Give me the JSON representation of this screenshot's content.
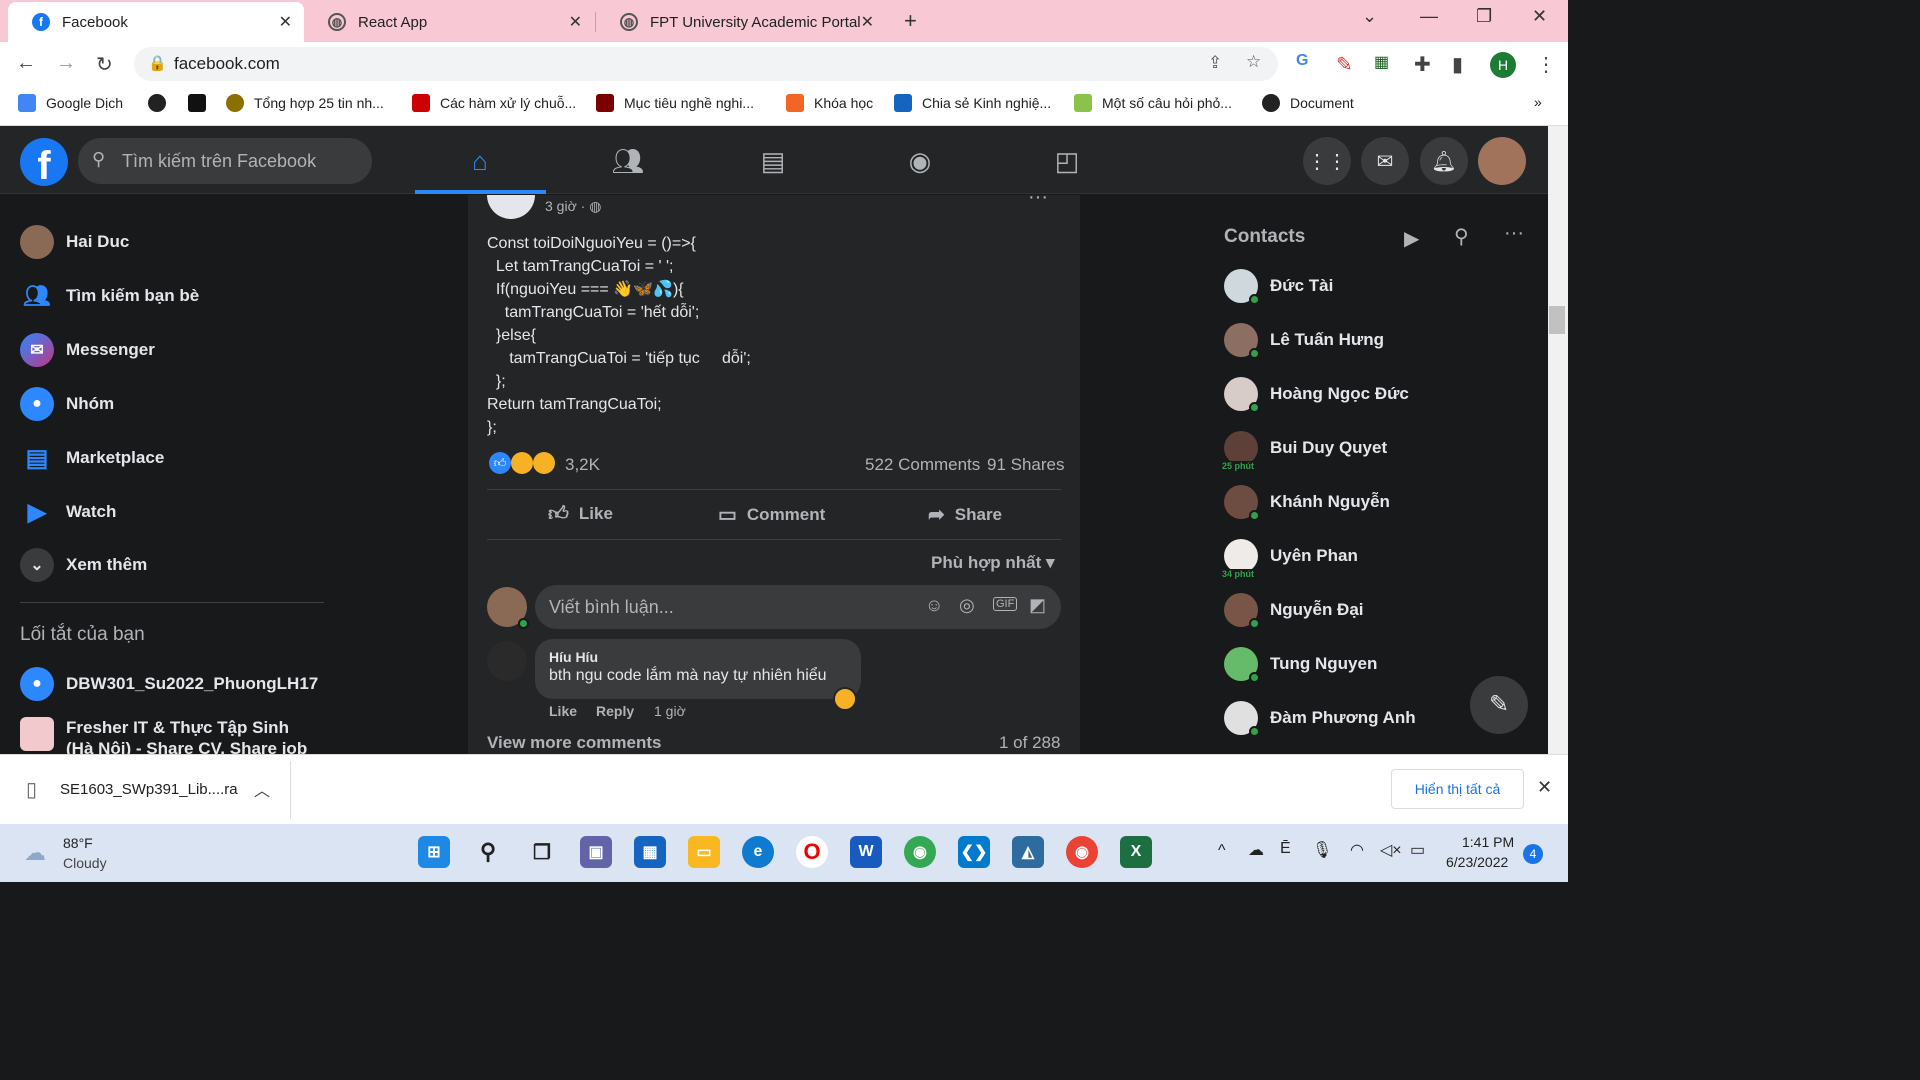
{
  "browser": {
    "tabs": [
      {
        "label": "Facebook"
      },
      {
        "label": "React App"
      },
      {
        "label": "FPT University Academic Portal"
      }
    ],
    "url": "facebook.com",
    "bookmarks": [
      "Google Dịch",
      "Tổng hợp 25 tin nh...",
      "Các hàm xử lý chuỗ...",
      "Mục tiêu nghề nghi...",
      "Khóa học",
      "Chia sẻ Kinh nghiệ...",
      "Một số câu hỏi phỏ...",
      "Document"
    ],
    "profile_initial": "H",
    "bookmarks_more": "»"
  },
  "fb": {
    "search_placeholder": "Tìm kiếm trên Facebook",
    "left": {
      "items": [
        "Hai Duc",
        "Tìm kiếm bạn bè",
        "Messenger",
        "Nhóm",
        "Marketplace",
        "Watch",
        "Xem thêm"
      ],
      "shortcuts_title": "Lối tắt của bạn",
      "shortcuts": [
        "DBW301_Su2022_PhuongLH17",
        "Fresher IT & Thực Tập Sinh (Hà Nội) - Share CV, Share job"
      ]
    },
    "post": {
      "time": "3 giờ ·",
      "code": "Const toiDoiNguoiYeu = ()=>{\n  Let tamTrangCuaToi = ' ';\n  If(nguoiYeu === 👋🦋💦){\n    tamTrangCuaToi = 'hết dỗi';\n  }else{\n     tamTrangCuaToi = 'tiếp tục     dỗi';\n  };\nReturn tamTrangCuaToi;\n};",
      "reactions": "3,2K",
      "comments": "522 Comments",
      "shares": "91 Shares",
      "like": "Like",
      "comment": "Comment",
      "share": "Share",
      "sort": "Phù hợp nhất",
      "comment_placeholder": "Viết bình luận...",
      "c_author": "Híu Híu",
      "c_text": "bth ngu code lắm mà nay tự nhiên hiểu",
      "c_like": "Like",
      "c_reply": "Reply",
      "c_time": "1 giờ",
      "view_more": "View more comments",
      "count": "1 of 288"
    },
    "contacts_title": "Contacts",
    "contacts": [
      {
        "name": "Đức Tài",
        "badge": ""
      },
      {
        "name": "Lê Tuấn Hưng",
        "badge": ""
      },
      {
        "name": "Hoàng Ngọc Đức",
        "badge": ""
      },
      {
        "name": "Bui Duy Quyet",
        "badge": "25 phút"
      },
      {
        "name": "Khánh Nguyễn",
        "badge": ""
      },
      {
        "name": "Uyên Phan",
        "badge": "34 phút"
      },
      {
        "name": "Nguyễn Đại",
        "badge": ""
      },
      {
        "name": "Tung Nguyen",
        "badge": ""
      },
      {
        "name": "Đàm Phương Anh",
        "badge": ""
      }
    ]
  },
  "download": {
    "file": "SE1603_SWp391_Lib....ra",
    "show_all": "Hiển thị tất cả"
  },
  "taskbar": {
    "temp": "88°F",
    "weather": "Cloudy",
    "time": "1:41 PM",
    "date": "6/23/2022",
    "notif": "4"
  }
}
